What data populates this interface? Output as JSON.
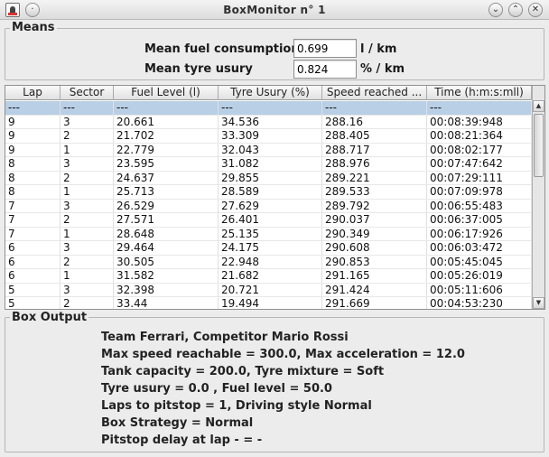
{
  "window": {
    "title": "BoxMonitor n° 1"
  },
  "means": {
    "group_title": "Means",
    "fuel_label": "Mean fuel consumption",
    "fuel_value": "0.699",
    "fuel_unit": "l / km",
    "tyre_label": "Mean tyre usury",
    "tyre_value": "0.824",
    "tyre_unit": "% / km"
  },
  "table": {
    "columns": [
      "Lap",
      "Sector",
      "Fuel Level (l)",
      "Tyre Usury (%)",
      "Speed reached ...",
      "Time (h:m:s:mll)"
    ],
    "rows": [
      [
        "---",
        "---",
        "---",
        "---",
        "---",
        "---"
      ],
      [
        "9",
        "3",
        "20.661",
        "34.536",
        "288.16",
        "00:08:39:948"
      ],
      [
        "9",
        "2",
        "21.702",
        "33.309",
        "288.405",
        "00:08:21:364"
      ],
      [
        "9",
        "1",
        "22.779",
        "32.043",
        "288.717",
        "00:08:02:177"
      ],
      [
        "8",
        "3",
        "23.595",
        "31.082",
        "288.976",
        "00:07:47:642"
      ],
      [
        "8",
        "2",
        "24.637",
        "29.855",
        "289.221",
        "00:07:29:111"
      ],
      [
        "8",
        "1",
        "25.713",
        "28.589",
        "289.533",
        "00:07:09:978"
      ],
      [
        "7",
        "3",
        "26.529",
        "27.629",
        "289.792",
        "00:06:55:483"
      ],
      [
        "7",
        "2",
        "27.571",
        "26.401",
        "290.037",
        "00:06:37:005"
      ],
      [
        "7",
        "1",
        "28.648",
        "25.135",
        "290.349",
        "00:06:17:926"
      ],
      [
        "6",
        "3",
        "29.464",
        "24.175",
        "290.608",
        "00:06:03:472"
      ],
      [
        "6",
        "2",
        "30.505",
        "22.948",
        "290.853",
        "00:05:45:045"
      ],
      [
        "6",
        "1",
        "31.582",
        "21.682",
        "291.165",
        "00:05:26:019"
      ],
      [
        "5",
        "3",
        "32.398",
        "20.721",
        "291.424",
        "00:05:11:606"
      ],
      [
        "5",
        "2",
        "33.44",
        "19.494",
        "291.669",
        "00:04:53:230"
      ]
    ]
  },
  "box_output": {
    "group_title": "Box Output",
    "lines": [
      "Team Ferrari, Competitor Mario Rossi",
      "Max speed reachable = 300.0, Max acceleration = 12.0",
      "Tank capacity = 200.0, Tyre mixture = Soft",
      "Tyre usury = 0.0 , Fuel level = 50.0",
      "Laps to pitstop = 1, Driving style Normal",
      "Box Strategy = Normal",
      "Pitstop delay at lap - = -"
    ]
  },
  "icons": {
    "app": "app-icon",
    "menu": "window-menu-icon",
    "minimize": "chevron-down-icon",
    "maximize": "chevron-up-icon",
    "close": "close-icon"
  }
}
